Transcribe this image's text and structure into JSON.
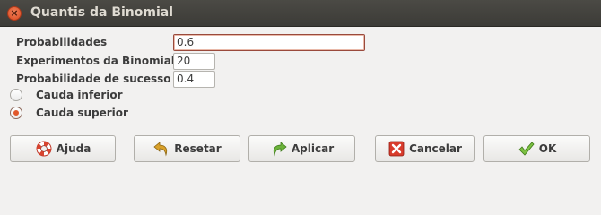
{
  "window": {
    "title": "Quantis da Binomial",
    "close_glyph": "×"
  },
  "form": {
    "probabilities_label": "Probabilidades",
    "probabilities_value": "0.6",
    "trials_label": "Experimentos da Binomial",
    "trials_value": "20",
    "success_label": "Probabilidade de sucesso",
    "success_value": "0.4"
  },
  "tail": {
    "options": [
      {
        "label": "Cauda inferior",
        "checked": false
      },
      {
        "label": "Cauda superior",
        "checked": true
      }
    ]
  },
  "buttons": {
    "help": {
      "label": "Ajuda",
      "icon": "lifebuoy-icon"
    },
    "reset": {
      "label": "Resetar",
      "icon": "undo-arrow-icon"
    },
    "apply": {
      "label": "Aplicar",
      "icon": "redo-arrow-icon"
    },
    "cancel": {
      "label": "Cancelar",
      "icon": "red-x-icon"
    },
    "ok": {
      "label": "OK",
      "icon": "checkmark-icon"
    }
  },
  "colors": {
    "titlebar": "#3c3b37",
    "close": "#e1572a",
    "accent": "#e1572a"
  }
}
